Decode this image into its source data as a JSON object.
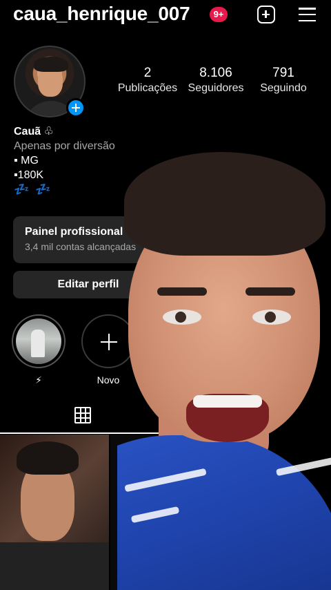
{
  "header": {
    "username": "caua_henrique_007",
    "notification_badge": "9+",
    "new_post_icon": "plus-square-icon",
    "menu_icon": "hamburger-menu-icon"
  },
  "profile": {
    "stats": [
      {
        "value": "2",
        "label": "Publicações"
      },
      {
        "value": "8.106",
        "label": "Seguidores"
      },
      {
        "value": "791",
        "label": "Seguindo"
      }
    ],
    "bio": {
      "name": "Cauã ♧",
      "category": "Apenas por diversão",
      "line1": "▪ MG",
      "line2": "▪180K",
      "line3": "💤 💤"
    }
  },
  "professional_panel": {
    "title": "Painel profissional",
    "subtitle": "3,4 mil contas alcançadas"
  },
  "buttons": {
    "edit_profile": "Editar perfil"
  },
  "highlights": [
    {
      "label": "⚡"
    },
    {
      "label": "Novo"
    }
  ],
  "tabs": {
    "active": "grid-icon"
  },
  "colors": {
    "background": "#000000",
    "badge": "#e8194b",
    "accent_blue": "#0095f6",
    "panel": "#262626"
  }
}
